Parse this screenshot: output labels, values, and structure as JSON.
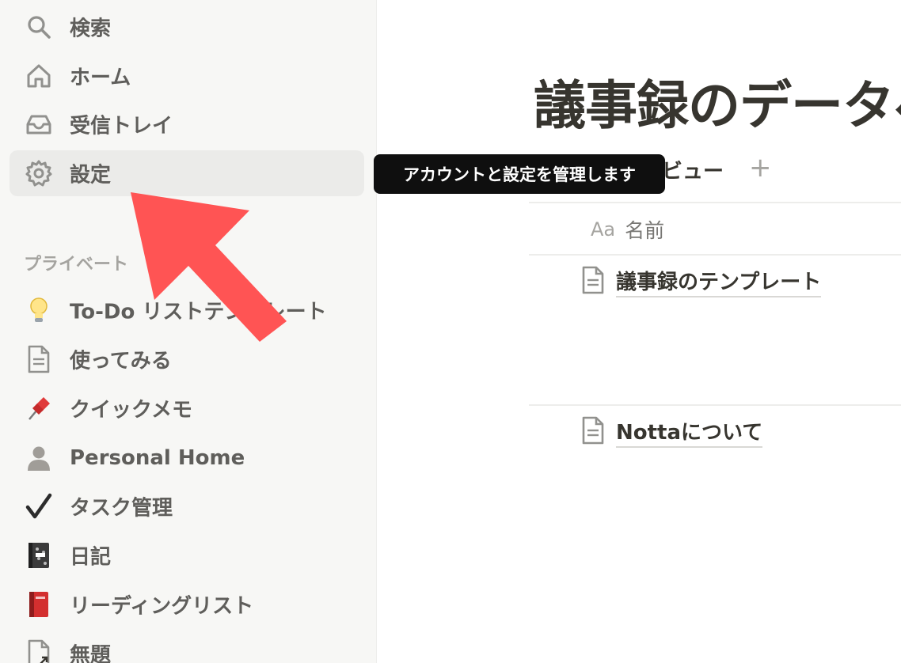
{
  "sidebar": {
    "top_items": [
      {
        "label": "検索",
        "icon": "search-icon"
      },
      {
        "label": "ホーム",
        "icon": "home-icon"
      },
      {
        "label": "受信トレイ",
        "icon": "inbox-icon"
      },
      {
        "label": "設定",
        "icon": "gear-icon"
      }
    ],
    "section_label": "プライベート",
    "pages": [
      {
        "label": "To-Do リストテンプレート",
        "icon": "lightbulb-icon"
      },
      {
        "label": "使ってみる",
        "icon": "document-icon"
      },
      {
        "label": "クイックメモ",
        "icon": "pushpin-icon"
      },
      {
        "label": "Personal Home",
        "icon": "person-icon"
      },
      {
        "label": "タスク管理",
        "icon": "checkmark-icon"
      },
      {
        "label": "日記",
        "icon": "notebook-icon"
      },
      {
        "label": "リーディングリスト",
        "icon": "red-book-icon"
      },
      {
        "label": "無題",
        "icon": "document-link-icon"
      }
    ]
  },
  "tooltip": {
    "text": "アカウントと設定を管理します"
  },
  "main": {
    "title": "議事録のデータベ",
    "view_tab": "ビュー",
    "add_view": "+",
    "column_header": {
      "type_icon": "Aa",
      "name": "名前"
    },
    "rows": [
      {
        "title": "議事録のテンプレート",
        "icon": "document-icon"
      },
      {
        "title": "Nottaについて",
        "icon": "document-icon"
      }
    ]
  },
  "colors": {
    "sidebar_bg": "#f7f7f5",
    "active_item_bg": "#ebebe9",
    "tooltip_bg": "#0f0f0f",
    "annotation_arrow": "#ff5454"
  }
}
